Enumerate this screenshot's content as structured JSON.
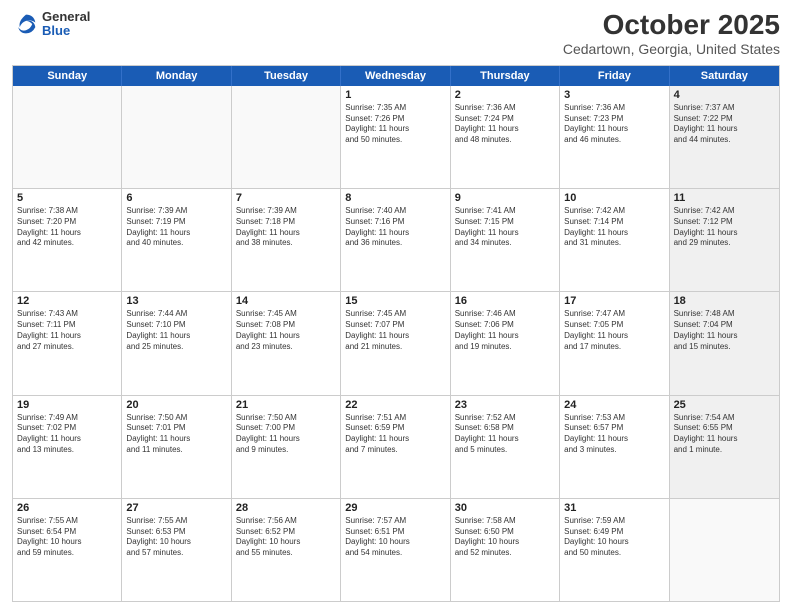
{
  "logo": {
    "general": "General",
    "blue": "Blue"
  },
  "title": "October 2025",
  "location": "Cedartown, Georgia, United States",
  "days_of_week": [
    "Sunday",
    "Monday",
    "Tuesday",
    "Wednesday",
    "Thursday",
    "Friday",
    "Saturday"
  ],
  "rows": [
    [
      {
        "day": "",
        "info": "",
        "empty": true
      },
      {
        "day": "",
        "info": "",
        "empty": true
      },
      {
        "day": "",
        "info": "",
        "empty": true
      },
      {
        "day": "1",
        "info": "Sunrise: 7:35 AM\nSunset: 7:26 PM\nDaylight: 11 hours\nand 50 minutes."
      },
      {
        "day": "2",
        "info": "Sunrise: 7:36 AM\nSunset: 7:24 PM\nDaylight: 11 hours\nand 48 minutes."
      },
      {
        "day": "3",
        "info": "Sunrise: 7:36 AM\nSunset: 7:23 PM\nDaylight: 11 hours\nand 46 minutes."
      },
      {
        "day": "4",
        "info": "Sunrise: 7:37 AM\nSunset: 7:22 PM\nDaylight: 11 hours\nand 44 minutes.",
        "shaded": true
      }
    ],
    [
      {
        "day": "5",
        "info": "Sunrise: 7:38 AM\nSunset: 7:20 PM\nDaylight: 11 hours\nand 42 minutes."
      },
      {
        "day": "6",
        "info": "Sunrise: 7:39 AM\nSunset: 7:19 PM\nDaylight: 11 hours\nand 40 minutes."
      },
      {
        "day": "7",
        "info": "Sunrise: 7:39 AM\nSunset: 7:18 PM\nDaylight: 11 hours\nand 38 minutes."
      },
      {
        "day": "8",
        "info": "Sunrise: 7:40 AM\nSunset: 7:16 PM\nDaylight: 11 hours\nand 36 minutes."
      },
      {
        "day": "9",
        "info": "Sunrise: 7:41 AM\nSunset: 7:15 PM\nDaylight: 11 hours\nand 34 minutes."
      },
      {
        "day": "10",
        "info": "Sunrise: 7:42 AM\nSunset: 7:14 PM\nDaylight: 11 hours\nand 31 minutes."
      },
      {
        "day": "11",
        "info": "Sunrise: 7:42 AM\nSunset: 7:12 PM\nDaylight: 11 hours\nand 29 minutes.",
        "shaded": true
      }
    ],
    [
      {
        "day": "12",
        "info": "Sunrise: 7:43 AM\nSunset: 7:11 PM\nDaylight: 11 hours\nand 27 minutes."
      },
      {
        "day": "13",
        "info": "Sunrise: 7:44 AM\nSunset: 7:10 PM\nDaylight: 11 hours\nand 25 minutes."
      },
      {
        "day": "14",
        "info": "Sunrise: 7:45 AM\nSunset: 7:08 PM\nDaylight: 11 hours\nand 23 minutes."
      },
      {
        "day": "15",
        "info": "Sunrise: 7:45 AM\nSunset: 7:07 PM\nDaylight: 11 hours\nand 21 minutes."
      },
      {
        "day": "16",
        "info": "Sunrise: 7:46 AM\nSunset: 7:06 PM\nDaylight: 11 hours\nand 19 minutes."
      },
      {
        "day": "17",
        "info": "Sunrise: 7:47 AM\nSunset: 7:05 PM\nDaylight: 11 hours\nand 17 minutes."
      },
      {
        "day": "18",
        "info": "Sunrise: 7:48 AM\nSunset: 7:04 PM\nDaylight: 11 hours\nand 15 minutes.",
        "shaded": true
      }
    ],
    [
      {
        "day": "19",
        "info": "Sunrise: 7:49 AM\nSunset: 7:02 PM\nDaylight: 11 hours\nand 13 minutes."
      },
      {
        "day": "20",
        "info": "Sunrise: 7:50 AM\nSunset: 7:01 PM\nDaylight: 11 hours\nand 11 minutes."
      },
      {
        "day": "21",
        "info": "Sunrise: 7:50 AM\nSunset: 7:00 PM\nDaylight: 11 hours\nand 9 minutes."
      },
      {
        "day": "22",
        "info": "Sunrise: 7:51 AM\nSunset: 6:59 PM\nDaylight: 11 hours\nand 7 minutes."
      },
      {
        "day": "23",
        "info": "Sunrise: 7:52 AM\nSunset: 6:58 PM\nDaylight: 11 hours\nand 5 minutes."
      },
      {
        "day": "24",
        "info": "Sunrise: 7:53 AM\nSunset: 6:57 PM\nDaylight: 11 hours\nand 3 minutes."
      },
      {
        "day": "25",
        "info": "Sunrise: 7:54 AM\nSunset: 6:55 PM\nDaylight: 11 hours\nand 1 minute.",
        "shaded": true
      }
    ],
    [
      {
        "day": "26",
        "info": "Sunrise: 7:55 AM\nSunset: 6:54 PM\nDaylight: 10 hours\nand 59 minutes."
      },
      {
        "day": "27",
        "info": "Sunrise: 7:55 AM\nSunset: 6:53 PM\nDaylight: 10 hours\nand 57 minutes."
      },
      {
        "day": "28",
        "info": "Sunrise: 7:56 AM\nSunset: 6:52 PM\nDaylight: 10 hours\nand 55 minutes."
      },
      {
        "day": "29",
        "info": "Sunrise: 7:57 AM\nSunset: 6:51 PM\nDaylight: 10 hours\nand 54 minutes."
      },
      {
        "day": "30",
        "info": "Sunrise: 7:58 AM\nSunset: 6:50 PM\nDaylight: 10 hours\nand 52 minutes."
      },
      {
        "day": "31",
        "info": "Sunrise: 7:59 AM\nSunset: 6:49 PM\nDaylight: 10 hours\nand 50 minutes."
      },
      {
        "day": "",
        "info": "",
        "empty": true,
        "shaded": true
      }
    ]
  ]
}
